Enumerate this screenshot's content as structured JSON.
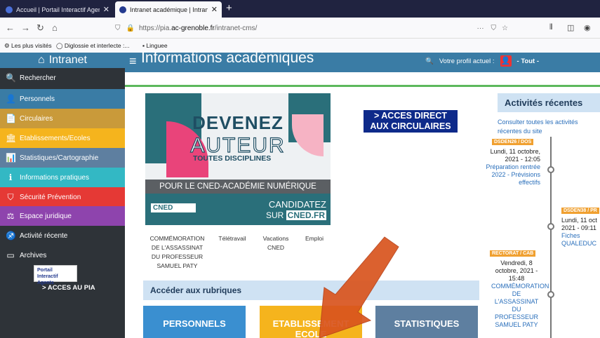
{
  "browser": {
    "tabs": [
      {
        "title": "Accueil | Portail Interactif Agen",
        "close": "✕"
      },
      {
        "title": "Intranet académique | Intranet",
        "close": "✕"
      }
    ],
    "new_tab": "+",
    "url_prefix": "https://pia.",
    "url_domain": "ac-grenoble.fr",
    "url_path": "/intranet-cms/",
    "url_more": "···",
    "bookmarks": [
      {
        "label": "Les plus visités"
      },
      {
        "label": "Diglossie et interlecte :..."
      },
      {
        "label": "Linguee"
      }
    ]
  },
  "sidebar": {
    "title": "Intranet",
    "items": [
      {
        "label": "Rechercher",
        "icon": "search-icon",
        "color": "#2e3338"
      },
      {
        "label": "Personnels",
        "icon": "user-icon",
        "color": "#3a7ca5"
      },
      {
        "label": "Circulaires",
        "icon": "document-icon",
        "color": "#c99a3a"
      },
      {
        "label": "Etablissements/Ecoles",
        "icon": "institution-icon",
        "color": "#f5b41d"
      },
      {
        "label": "Statistiques/Cartographie",
        "icon": "bar-chart-icon",
        "color": "#5e7fa0"
      },
      {
        "label": "Informations pratiques",
        "icon": "info-icon",
        "color": "#33b8c4"
      },
      {
        "label": "Sécurité Prévention",
        "icon": "shield-icon",
        "color": "#e53935"
      },
      {
        "label": "Espace juridique",
        "icon": "scales-icon",
        "color": "#8e44ad"
      },
      {
        "label": "Activité récente",
        "icon": "activity-icon",
        "color": "#2e3338"
      },
      {
        "label": "Archives",
        "icon": "archive-icon",
        "color": "#2e3338"
      }
    ],
    "pia_logo": "Portail Interactif Agents",
    "pia_link": "> ACCES AU PIA"
  },
  "header": {
    "title": "Informations académiques",
    "profile_label": "Votre profil actuel :",
    "profile_value": "- Tout -"
  },
  "banner": {
    "line1": "DEVENEZ",
    "line2": "AUTEUR",
    "line3": "TOUTES DISCIPLINES",
    "band": "POUR LE CNED-ACADÉMIE NUMÉRIQUE",
    "cned": "CNED",
    "candidatez": "CANDIDATEZ",
    "sur": "SUR",
    "site": "CNED.FR"
  },
  "acces_direct": {
    "line1": "> ACCES DIRECT",
    "line2": "AUX CIRCULAIRES"
  },
  "quick_links": [
    {
      "label": "COMMÉMORATION DE L'ASSASSINAT DU PROFESSEUR SAMUEL PATY"
    },
    {
      "label": "Télétravail"
    },
    {
      "label": "Vacations CNED"
    },
    {
      "label": "Emploi"
    }
  ],
  "rubriques": {
    "title": "Accéder aux rubriques",
    "cards": [
      {
        "label": "PERSONNELS",
        "color": "#3a8fd0"
      },
      {
        "label": "ETABLISSEMENT ECOLE",
        "color": "#f5b41d"
      },
      {
        "label": "STATISTIQUES",
        "color": "#5e7fa0"
      }
    ]
  },
  "activity": {
    "title": "Activités récentes",
    "consult_link": "Consulter toutes les activités récentes du site",
    "events": [
      {
        "tag": "DSDEN26 / DOS",
        "date": "Lundi, 11 octobre, 2021 - 12:05",
        "title": "Préparation rentrée 2022 - Prévisions effectifs"
      },
      {
        "tag": "DSDEN38 / PR",
        "date": "Lundi, 11 oct 2021 - 09:11",
        "title": "Fiches QUALEDUC"
      },
      {
        "tag": "RECTORAT / CAB",
        "date": "Vendredi, 8 octobre, 2021 - 15:48",
        "title": "COMMÉMORATION DE L'ASSASSINAT DU PROFESSEUR SAMUEL PATY"
      }
    ]
  },
  "colors": {
    "header": "#3a7ca5",
    "sidebar": "#2e3338",
    "arrow": "#d9541e"
  }
}
